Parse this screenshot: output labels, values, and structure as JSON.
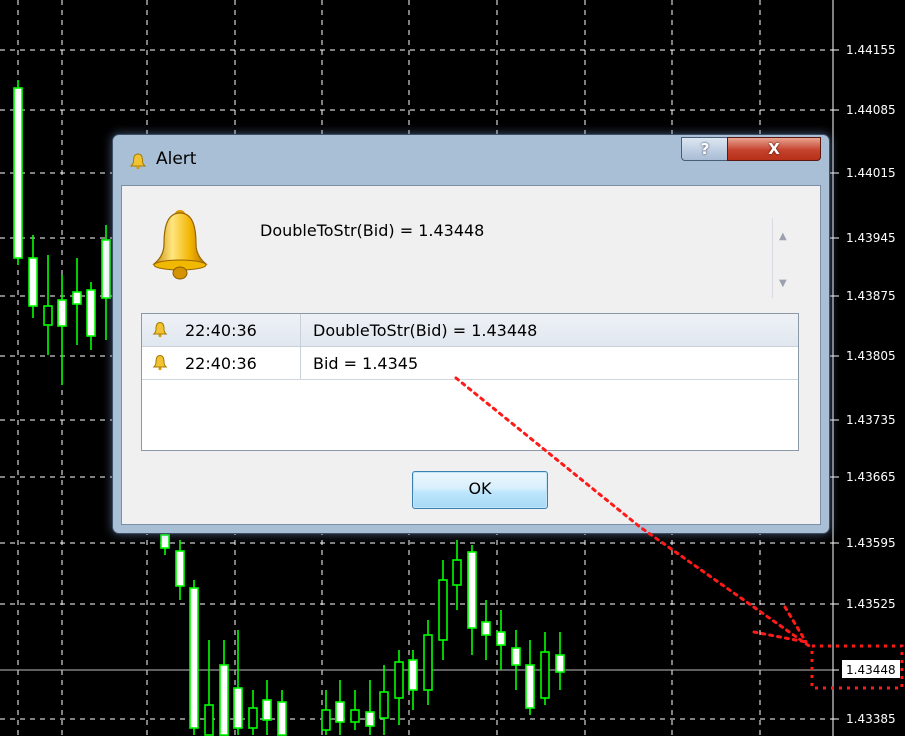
{
  "chart": {
    "price_scale": [
      "1.44155",
      "1.44085",
      "1.44015",
      "1.43945",
      "1.43875",
      "1.43805",
      "1.43735",
      "1.43665",
      "1.43595",
      "1.43525",
      "1.43448",
      "1.43385"
    ],
    "current_bid": "1.43448",
    "colors": {
      "background": "#000000",
      "candle": "#00ff00",
      "grid": "#ffffff",
      "annotation": "#ff0000"
    }
  },
  "dialog": {
    "title": "Alert",
    "help_label": "?",
    "close_label": "X",
    "message": "DoubleToStr(Bid) = 1.43448",
    "rows": [
      {
        "time": "22:40:36",
        "message": "DoubleToStr(Bid) = 1.43448"
      },
      {
        "time": "22:40:36",
        "message": "Bid = 1.4345"
      }
    ],
    "ok_label": "OK",
    "icons": {
      "title": "bell-icon",
      "main": "bell-icon",
      "row": "bell-icon",
      "scroll_up": "scroll-up-arrow",
      "scroll_down": "scroll-down-arrow"
    }
  }
}
